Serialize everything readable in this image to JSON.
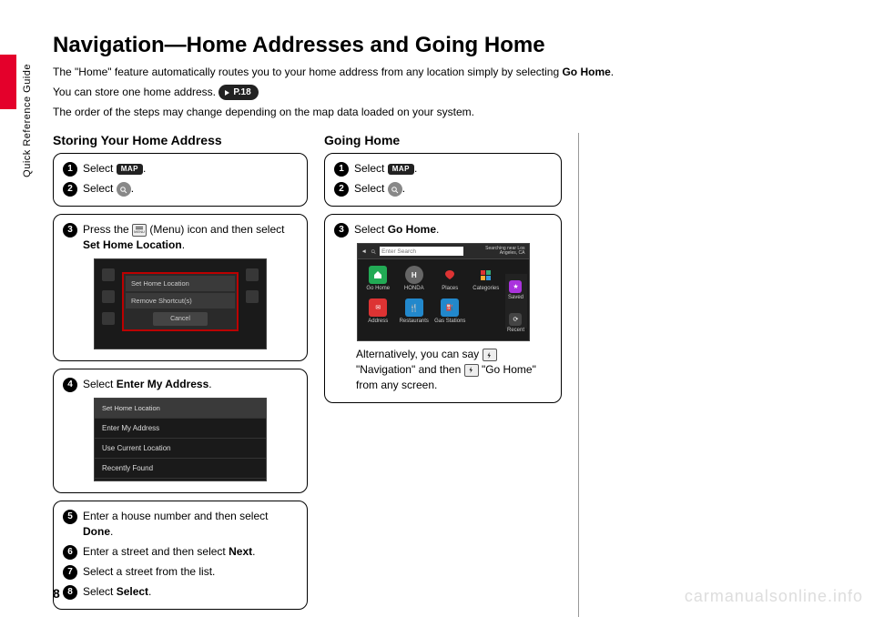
{
  "sideLabel": "Quick Reference Guide",
  "pageNumber": "8",
  "watermark": "carmanualsonline.info",
  "title": "Navigation—Home Addresses and Going Home",
  "intro1_a": "The \"Home\" feature automatically routes you to your home address from any location simply by selecting ",
  "intro1_b": "Go Home",
  "intro1_c": ".",
  "intro2": "You can store one home address. ",
  "pref": "P.18",
  "intro3": "The order of the steps may change depending on the map data loaded on your system.",
  "left": {
    "heading": "Storing Your Home Address",
    "s1": "Select ",
    "s1_chip": "MAP",
    "s2": "Select ",
    "s3a": "Press the ",
    "s3b": " (Menu) icon and then select ",
    "s3c": "Set Home Location",
    "shot1": {
      "row1": "Set Home Location",
      "row2": "Remove Shortcut(s)",
      "cancel": "Cancel"
    },
    "s4a": "Select ",
    "s4b": "Enter My Address",
    "shot2": {
      "hd": "Set Home Location",
      "r1": "Enter My Address",
      "r2": "Use Current Location",
      "r3": "Recently Found"
    },
    "s5a": "Enter a house number and then select ",
    "s5b": "Done",
    "s6a": "Enter a street and then select ",
    "s6b": "Next",
    "s7": "Select a street from the list.",
    "s8a": "Select ",
    "s8b": "Select"
  },
  "right": {
    "heading": "Going Home",
    "s1": "Select ",
    "s1_chip": "MAP",
    "s2": "Select ",
    "s3a": "Select ",
    "s3b": "Go Home",
    "shot3": {
      "search": "Enter Search",
      "near": "Searching near Los Angeles, CA",
      "c1": "Go Home",
      "c2": "HONDA",
      "c3": "Places",
      "c4": "Categories",
      "c5": "Address",
      "c6": "Restaurants",
      "c7": "Gas Stations",
      "r1": "Saved",
      "r2": "Recent"
    },
    "alt_a": "Alternatively, you can say ",
    "alt_b": "\"",
    "alt_c": "Navigation",
    "alt_d": "\" and then ",
    "alt_e": " \"",
    "alt_f": "Go Home",
    "alt_g": "\" from any screen."
  }
}
